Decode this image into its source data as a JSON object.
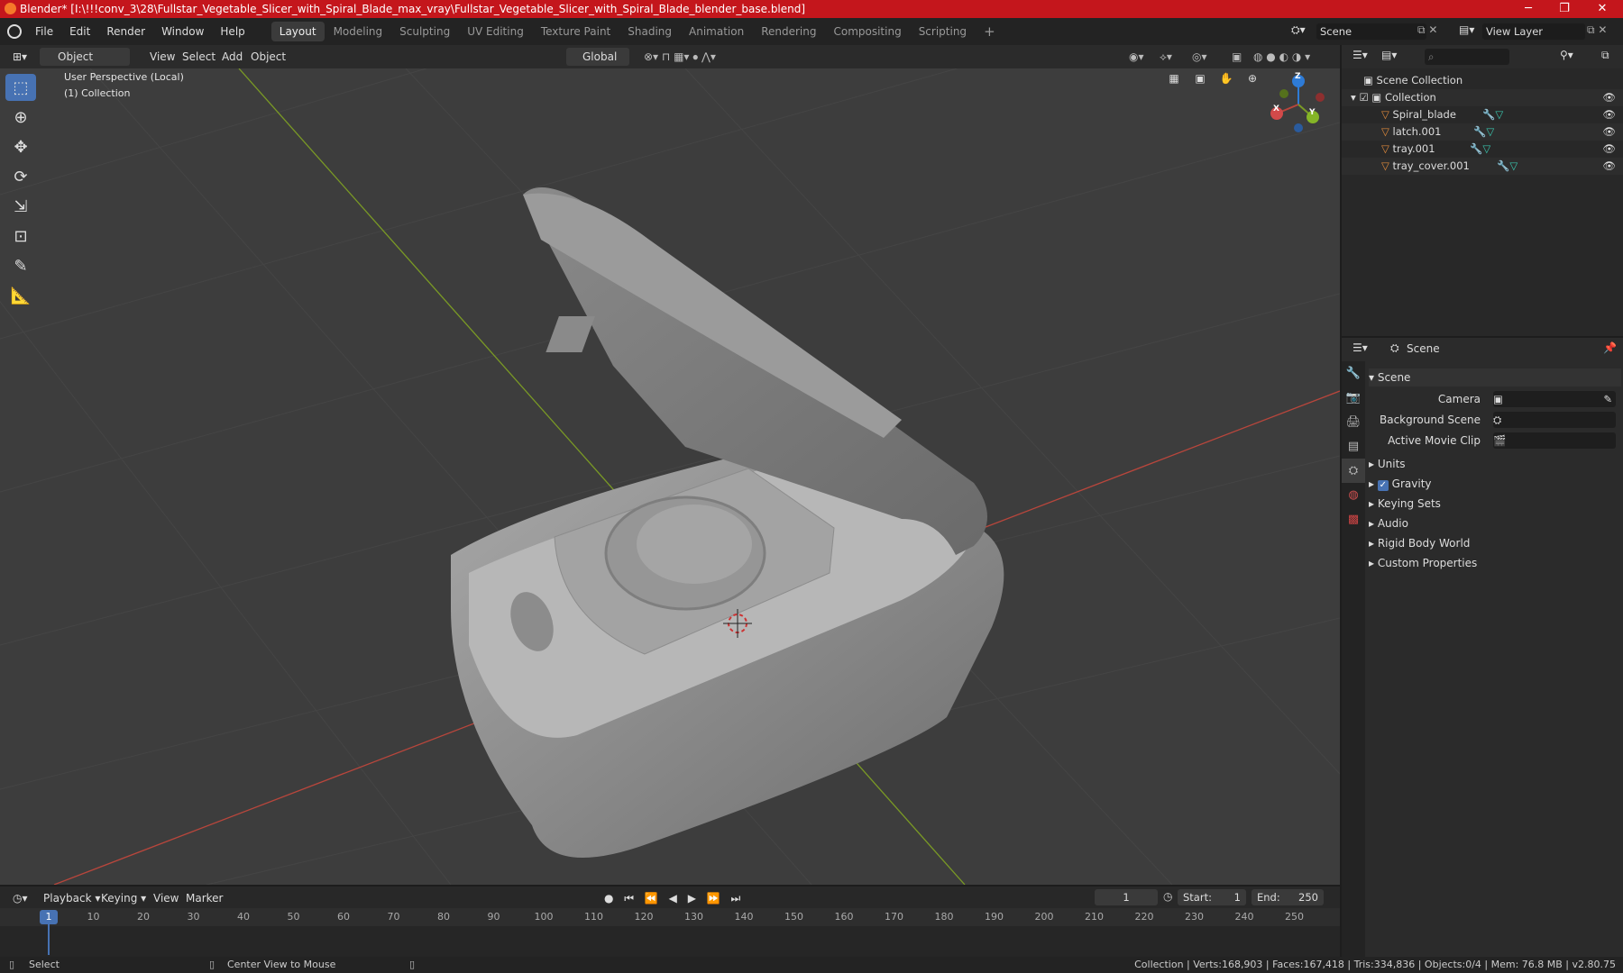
{
  "window": {
    "title": "Blender* [I:\\!!!conv_3\\28\\Fullstar_Vegetable_Slicer_with_Spiral_Blade_max_vray\\Fullstar_Vegetable_Slicer_with_Spiral_Blade_blender_base.blend]",
    "minimize": "─",
    "maximize": "❐",
    "close": "✕"
  },
  "menu": [
    "File",
    "Edit",
    "Render",
    "Window",
    "Help"
  ],
  "workspaces": [
    "Layout",
    "Modeling",
    "Sculpting",
    "UV Editing",
    "Texture Paint",
    "Shading",
    "Animation",
    "Rendering",
    "Compositing",
    "Scripting"
  ],
  "add_tab": "+",
  "scene_field": "Scene",
  "view_layer_field": "View Layer",
  "viewport_header": {
    "mode": "Object Mode",
    "menus": [
      "View",
      "Select",
      "Add",
      "Object"
    ],
    "orientation": "Global"
  },
  "viewport": {
    "info_line1": "User Perspective (Local)",
    "info_line2": "(1) Collection",
    "gizmo": {
      "x": "X",
      "y": "Y",
      "z": "Z"
    }
  },
  "outliner": {
    "root": "Scene Collection",
    "collection": "Collection",
    "objects": [
      "Spiral_blade",
      "latch.001",
      "tray.001",
      "tray_cover.001"
    ]
  },
  "properties": {
    "context": "Scene",
    "panel": "Scene",
    "fields": [
      {
        "label": "Camera",
        "value": ""
      },
      {
        "label": "Background Scene",
        "value": ""
      },
      {
        "label": "Active Movie Clip",
        "value": ""
      }
    ],
    "sections": [
      "Units",
      "Gravity",
      "Keying Sets",
      "Audio",
      "Rigid Body World",
      "Custom Properties"
    ],
    "gravity_checked": true
  },
  "timeline": {
    "menus": [
      "Playback",
      "Keying",
      "View",
      "Marker"
    ],
    "current_frame": "1",
    "start_label": "Start:",
    "start": "1",
    "end_label": "End:",
    "end": "250",
    "ticks": [
      "10",
      "20",
      "30",
      "40",
      "50",
      "60",
      "70",
      "80",
      "90",
      "100",
      "110",
      "120",
      "130",
      "140",
      "150",
      "160",
      "170",
      "180",
      "190",
      "200",
      "210",
      "220",
      "230",
      "240",
      "250"
    ],
    "frame_badge": "1"
  },
  "status": {
    "select": "Select",
    "center": "Center View to Mouse",
    "stats": "Collection | Verts:168,903 | Faces:167,418 | Tris:334,836 | Objects:0/4 | Mem: 76.8 MB | v2.80.75"
  },
  "colors": {
    "accent": "#4772b3",
    "titlebar": "#c4161c",
    "axis_x": "#b8463c",
    "axis_y": "#7a9a25",
    "gizmo_z": "#2e7bd6"
  }
}
